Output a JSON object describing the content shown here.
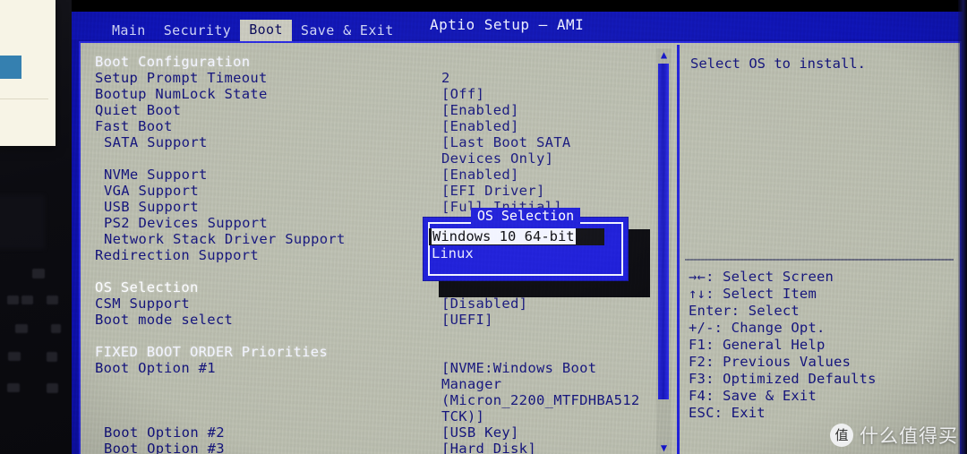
{
  "window": {
    "title": "Aptio Setup – AMI"
  },
  "menu": {
    "tabs": [
      {
        "label": "Main",
        "active": false
      },
      {
        "label": "Security",
        "active": false
      },
      {
        "label": "Boot",
        "active": true
      },
      {
        "label": "Save & Exit",
        "active": false
      }
    ]
  },
  "main": {
    "rows": [
      {
        "label": "Boot Configuration",
        "value": "",
        "style": "header",
        "indent": 0
      },
      {
        "label": "Setup Prompt Timeout",
        "value": "2",
        "style": "normal",
        "indent": 0
      },
      {
        "label": "Bootup NumLock State",
        "value": "[Off]",
        "style": "normal",
        "indent": 0
      },
      {
        "label": "Quiet Boot",
        "value": "[Enabled]",
        "style": "normal",
        "indent": 0
      },
      {
        "label": "Fast Boot",
        "value": "[Enabled]",
        "style": "normal",
        "indent": 0
      },
      {
        "label": "SATA Support",
        "value": "[Last Boot SATA",
        "style": "normal",
        "indent": 1
      },
      {
        "label": "",
        "value": "Devices Only]",
        "style": "normal",
        "indent": 0
      },
      {
        "label": "NVMe Support",
        "value": "[Enabled]",
        "style": "normal",
        "indent": 1
      },
      {
        "label": "VGA Support",
        "value": "[EFI Driver]",
        "style": "normal",
        "indent": 1
      },
      {
        "label": "USB Support",
        "value": "[Full Initial]",
        "style": "normal",
        "indent": 1
      },
      {
        "label": "PS2 Devices Support",
        "value": "",
        "style": "normal",
        "indent": 1
      },
      {
        "label": "Network Stack Driver Support",
        "value": "",
        "style": "normal",
        "indent": 1
      },
      {
        "label": "Redirection Support",
        "value": "",
        "style": "normal",
        "indent": 0
      },
      {
        "label": "",
        "value": "",
        "style": "normal",
        "indent": 0
      },
      {
        "label": "OS Selection",
        "value": "",
        "style": "active",
        "indent": 0
      },
      {
        "label": "CSM Support",
        "value": "[Disabled]",
        "style": "normal",
        "indent": 0
      },
      {
        "label": "Boot mode select",
        "value": "[UEFI]",
        "style": "normal",
        "indent": 0
      },
      {
        "label": "",
        "value": "",
        "style": "normal",
        "indent": 0
      },
      {
        "label": "FIXED BOOT ORDER Priorities",
        "value": "",
        "style": "header",
        "indent": 0
      },
      {
        "label": "Boot Option #1",
        "value": "[NVME:Windows Boot",
        "style": "normal",
        "indent": 0
      },
      {
        "label": "",
        "value": "Manager",
        "style": "normal",
        "indent": 0
      },
      {
        "label": "",
        "value": "(Micron_2200_MTFDHBA512",
        "style": "normal",
        "indent": 0
      },
      {
        "label": "",
        "value": "TCK)]",
        "style": "normal",
        "indent": 0
      },
      {
        "label": "Boot Option #2",
        "value": "[USB Key]",
        "style": "normal",
        "indent": 1
      },
      {
        "label": "Boot Option #3",
        "value": "[Hard Disk]",
        "style": "normal",
        "indent": 1
      }
    ]
  },
  "scrollbar": {
    "up_arrow": "▲",
    "down_arrow": "▼"
  },
  "help": {
    "text": "Select OS to install.",
    "keys": [
      "→←: Select Screen",
      "↑↓: Select Item",
      "Enter: Select",
      "+/-: Change Opt.",
      "F1: General Help",
      "F2: Previous Values",
      "F3: Optimized Defaults",
      "F4: Save & Exit",
      "ESC: Exit"
    ]
  },
  "popup": {
    "title": "OS Selection",
    "items": [
      {
        "label": "Windows 10 64-bit",
        "selected": true
      },
      {
        "label": "Linux",
        "selected": false
      }
    ]
  },
  "watermark": {
    "badge": "值",
    "text": "什么值得买"
  },
  "colors": {
    "screen_blue": "#0f14b4",
    "panel_gray": "#b9bcae",
    "text_blue": "#13137c",
    "accent_blue": "#2020d8",
    "highlight_white": "#f2f4ff"
  }
}
